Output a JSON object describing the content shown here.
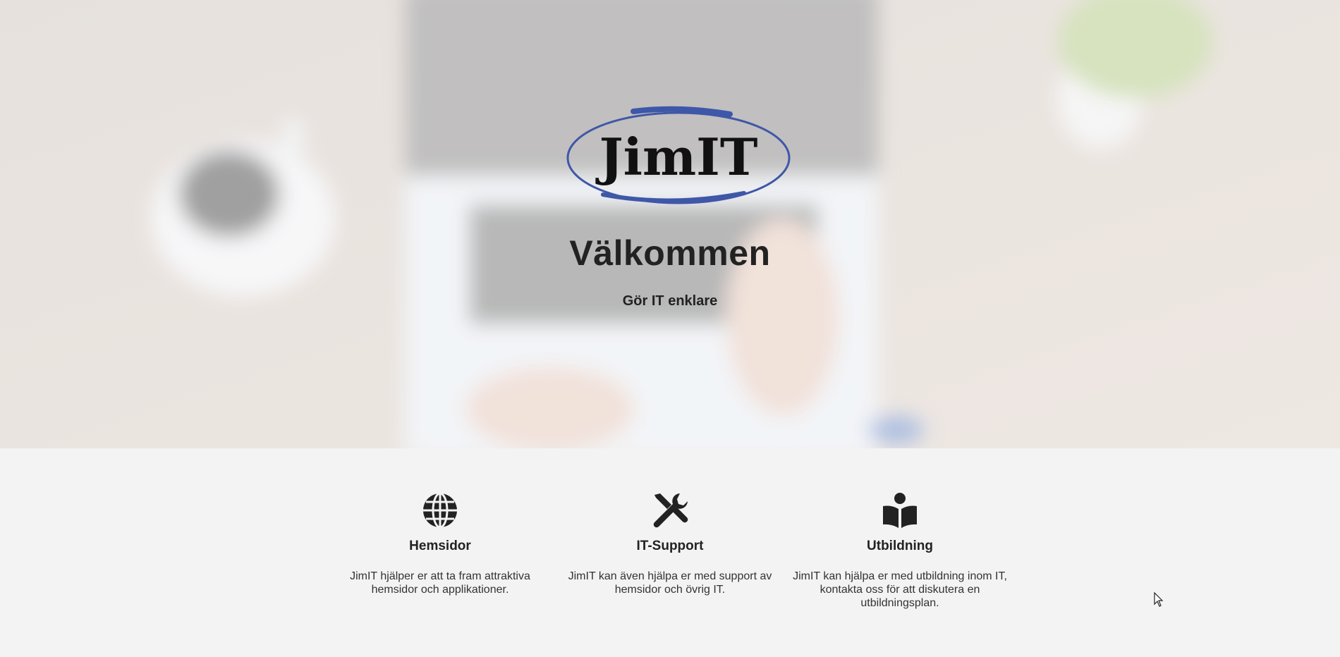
{
  "hero": {
    "logo_text": "JimIT",
    "title": "Välkommen",
    "tagline": "Gör IT enklare"
  },
  "colors": {
    "logo_ring": "#3f57a8",
    "text": "#222222",
    "section_bg": "#f3f3f3"
  },
  "features": [
    {
      "icon": "globe-icon",
      "title": "Hemsidor",
      "text": "JimIT hjälper er att ta fram attraktiva hemsidor och applikationer."
    },
    {
      "icon": "tools-icon",
      "title": "IT-Support",
      "text": "JimIT kan även hjälpa er med support av hemsidor och övrig IT."
    },
    {
      "icon": "book-reader-icon",
      "title": "Utbildning",
      "text": "JimIT kan hjälpa er med utbildning inom IT, kontakta oss för att diskutera en utbildningsplan."
    }
  ]
}
